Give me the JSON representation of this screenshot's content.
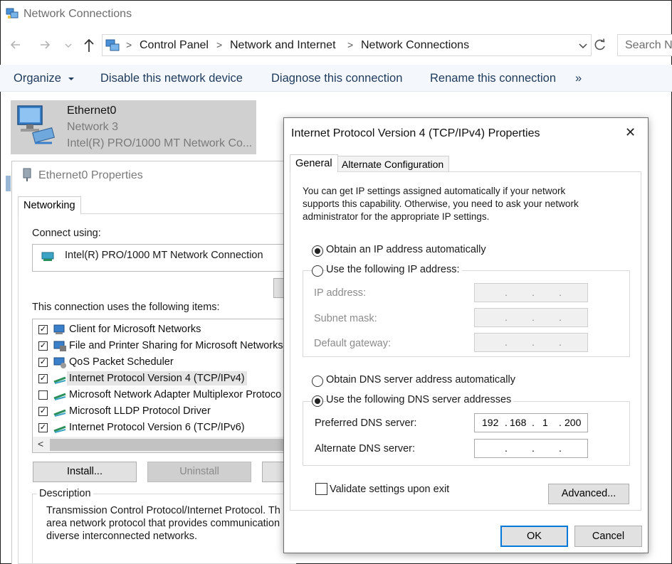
{
  "explorer": {
    "title": "Network Connections",
    "breadcrumb": [
      "Control Panel",
      "Network and Internet",
      "Network Connections"
    ],
    "search_placeholder": "Search N",
    "commands": [
      "Organize",
      "Disable this network device",
      "Diagnose this connection",
      "Rename this connection",
      "»"
    ],
    "adapter": {
      "name": "Ethernet0",
      "network": "Network 3",
      "device": "Intel(R) PRO/1000 MT Network Co..."
    }
  },
  "props": {
    "title": "Ethernet0 Properties",
    "tab": "Networking",
    "connect_using_label": "Connect using:",
    "adapter_name": "Intel(R) PRO/1000 MT Network Connection",
    "items_label": "This connection uses the following items:",
    "items": [
      {
        "label": "Client for Microsoft Networks",
        "checked": "✓",
        "icon": "network-client-icon"
      },
      {
        "label": "File and Printer Sharing for Microsoft Networks",
        "checked": "✓",
        "icon": "file-sharing-icon"
      },
      {
        "label": "QoS Packet Scheduler",
        "checked": "✓",
        "icon": "qos-icon"
      },
      {
        "label": "Internet Protocol Version 4 (TCP/IPv4)",
        "checked": "✓",
        "icon": "protocol-icon"
      },
      {
        "label": "Microsoft Network Adapter Multiplexor Protoco",
        "checked": "",
        "icon": "protocol-icon"
      },
      {
        "label": "Microsoft LLDP Protocol Driver",
        "checked": "✓",
        "icon": "protocol-icon"
      },
      {
        "label": "Internet Protocol Version 6 (TCP/IPv6)",
        "checked": "✓",
        "icon": "protocol-icon"
      }
    ],
    "scroll_left": "<",
    "install_button": "Install...",
    "uninstall_button": "Uninstall",
    "description_label": "Description",
    "description_lines": [
      "Transmission Control Protocol/Internet Protocol. Th",
      "area network protocol that provides communication",
      "diverse interconnected networks."
    ]
  },
  "tcp": {
    "title": "Internet Protocol Version 4 (TCP/IPv4) Properties",
    "close": "✕",
    "tabs": [
      "General",
      "Alternate Configuration"
    ],
    "intro_lines": [
      "You can get IP settings assigned automatically if your network",
      "supports this capability. Otherwise, you need to ask your network",
      "administrator for the appropriate IP settings."
    ],
    "ip_auto_label": "Obtain an IP address automatically",
    "ip_manual_label": "Use the following IP address:",
    "ip_address_label": "IP address:",
    "subnet_label": "Subnet mask:",
    "gateway_label": "Default gateway:",
    "dns_auto_label": "Obtain DNS server address automatically",
    "dns_manual_label": "Use the following DNS server addresses",
    "preferred_dns_label": "Preferred DNS server:",
    "preferred_dns": [
      "192",
      "168",
      "1",
      "200"
    ],
    "alternate_dns_label": "Alternate DNS server:",
    "validate_label": "Validate settings upon exit",
    "advanced_button": "Advanced...",
    "ok_button": "OK",
    "cancel_button": "Cancel",
    "ip_mode": "automatic",
    "dns_mode": "manual",
    "dot": "."
  },
  "colors": {
    "accent_border": "#0078d7",
    "command_text": "#1e3a5c",
    "selected_item_bg": "#d0d0d0"
  }
}
